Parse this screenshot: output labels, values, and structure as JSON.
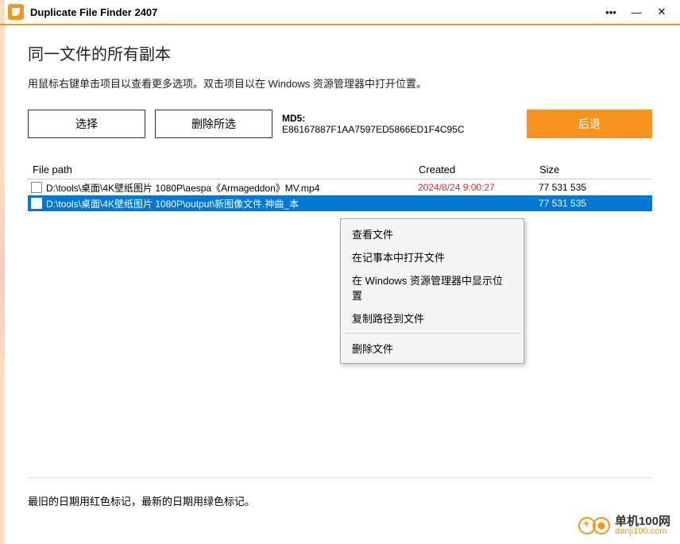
{
  "titlebar": {
    "title": "Duplicate File Finder 2407"
  },
  "heading": "同一文件的所有副本",
  "subtext": "用鼠标右键单击项目以查看更多选项。双击项目以在 Windows 资源管理器中打开位置。",
  "toolbar": {
    "select_label": "选择",
    "delete_label": "删除所选",
    "md5_label": "MD5:",
    "md5_value": "E86167887F1AA7597ED5866ED1F4C95C",
    "back_label": "后退"
  },
  "table": {
    "headers": {
      "path": "File path",
      "created": "Created",
      "size": "Size"
    },
    "rows": [
      {
        "path": "D:\\tools\\桌面\\4K壁纸图片 1080P\\aespa《Armageddon》MV.mp4",
        "created": "2024/8/24 9:00:27",
        "created_red": true,
        "size": "77 531 535",
        "selected": false
      },
      {
        "path": "D:\\tools\\桌面\\4K壁纸图片 1080P\\output\\新图像文件.神曲_本",
        "created": "",
        "created_red": false,
        "size": "77 531 535",
        "selected": true
      }
    ]
  },
  "context_menu": {
    "items": [
      "查看文件",
      "在记事本中打开文件",
      "在 Windows 资源管理器中显示位置",
      "复制路径到文件"
    ],
    "after_sep": [
      "删除文件"
    ]
  },
  "footer_note": "最旧的日期用红色标记，最新的日期用绿色标记。",
  "watermark": {
    "cn": "单机100网",
    "url": "danji100.com"
  }
}
